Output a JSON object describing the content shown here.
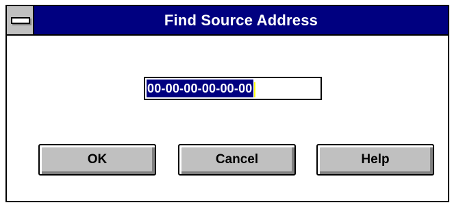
{
  "window": {
    "title": "Find Source Address",
    "system_menu_icon": "system-menu-bar-icon"
  },
  "address_field": {
    "value": "00-00-00-00-00-00"
  },
  "buttons": {
    "ok_label": "OK",
    "cancel_label": "Cancel",
    "help_label": "Help"
  },
  "colors": {
    "titlebar": "#000080",
    "face": "#c0c0c0",
    "selection": "#000080",
    "caret": "#ffff00"
  }
}
